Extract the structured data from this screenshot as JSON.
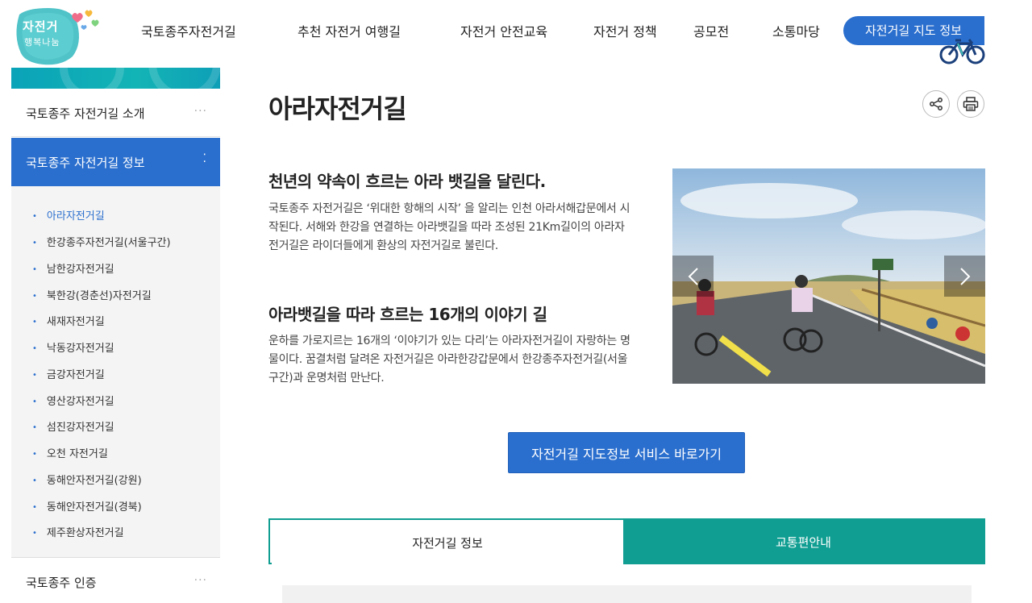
{
  "logo": {
    "line1": "자전거",
    "line2": "행복나눔"
  },
  "nav": {
    "items": [
      "국토종주자전거길",
      "추천 자전거 여행길",
      "자전거 안전교육",
      "자전거 정책",
      "공모전",
      "소통마당"
    ],
    "map_button": "자전거길 지도 정보"
  },
  "sidebar": {
    "top_item": "국토종주 자전거길 소개",
    "active_item": "국토종주 자전거길 정보",
    "sub_items": [
      "아라자전거길",
      "한강종주자전거길(서울구간)",
      "남한강자전거길",
      "북한강(경춘선)자전거길",
      "새재자전거길",
      "낙동강자전거길",
      "금강자전거길",
      "영산강자전거길",
      "섬진강자전거길",
      "오천 자전거길",
      "동해안자전거길(강원)",
      "동해안자전거길(경북)",
      "제주환상자전거길"
    ],
    "bottom_item": "국토종주 인증",
    "dots": "···",
    "active_dots": "⁚"
  },
  "main": {
    "title": "아라자전거길",
    "section1": {
      "heading": "천년의 약속이 흐르는 아라 뱃길을 달린다.",
      "body": "국토종주 자전거길은 ‘위대한 항해의 시작’ 을 알리는 인천 아라서해갑문에서 시작된다. 서해와 한강을 연결하는 아라뱃길을 따라 조성된 21Km길이의 아라자전거길은 라이더들에게 환상의 자전거길로 불린다."
    },
    "section2": {
      "heading": "아라뱃길을 따라 흐르는 16개의 이야기 길",
      "body": "운하를 가로지르는 16개의 ‘이야기가 있는 다리’는 아라자전거길이 자랑하는 명물이다. 꿈결처럼 달려온 자전거길은 아라한강갑문에서 한강종주자전거길(서울구간)과 운명처럼 만난다."
    },
    "map_service_button": "자전거길 지도정보 서비스 바로가기",
    "tabs": [
      "자전거길 정보",
      "교통편안내"
    ]
  },
  "colors": {
    "primary": "#2b6fce",
    "teal": "#109e92",
    "sidebar_banner": "#13b4b6"
  }
}
